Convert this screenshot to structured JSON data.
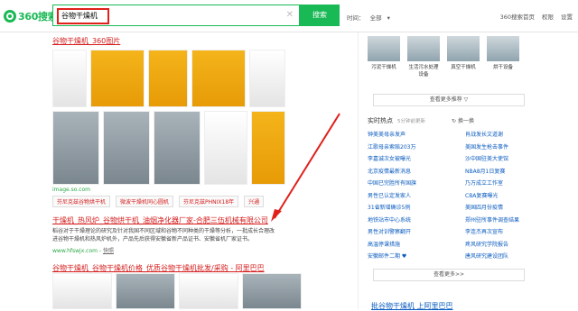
{
  "header": {
    "logo": "360搜索",
    "query": "谷物干燥机",
    "search_button": "搜索",
    "filter_time": "时间：",
    "filter_all": "全部",
    "links": [
      "360搜索首页",
      "权限",
      "设置"
    ]
  },
  "results": {
    "images_title": "谷物干燥机_360图片",
    "image_source": "image.so.com",
    "tags": [
      "芬尼克兹谷物烘干机",
      "微波干燥机同心圆机",
      "芬尼克兹PHNIX18年",
      "兴通"
    ],
    "res2_title": "干燥机_热风炉_谷物烘干机_油烟净化器厂家-合肥三伍机械有限公司",
    "res2_desc": "稻谷对于干燥理论的研究及针对我国不同区域和谷物不同种类的干燥等分析，一批成长合理改进谷物干燥机和热风炉机外，产品先后获得安徽省新产品证书、安徽省机厂家证书。",
    "res2_url": "www.hfswjx.com",
    "res2_cache": "快照",
    "res3_title": "谷物干燥机_谷物干燥机价格_优质谷物干燥机批发/采购 - 阿里巴巴"
  },
  "sidebar": {
    "related_images": [
      "污泥干燥机",
      "生活污水处理设备",
      "真空干燥机",
      "烘干设备"
    ],
    "more_related": "查看更多推荐 ▽",
    "hot_title": "实时热点",
    "hot_sub": "5分钟前更新",
    "hot_change": "换一换",
    "hot_items": [
      "钟美美母亲发声",
      "肖战发长文道谢",
      "江歌母亲索赔203万",
      "美国发生枪击事件",
      "李嘉诚次女被曝光",
      "沙中国驻美大使馆",
      "北京疫情最新消息",
      "NBA8月1日复赛",
      "中国已完胜所有国旗",
      "乃万成立工作室",
      "男性已认定发家人",
      "CBA复赛曝光",
      "31省新增确诊5例",
      "美国四月份疫情",
      "地铁站市中心系统",
      "郑州驻所事件调查结果",
      "男性对训警察翻开",
      "李连杰再次宣布",
      "高温停课措施",
      "疼风研究学院报告",
      "安徽邮件二期 ♥",
      "唐风研究建设团队"
    ],
    "more_hot": "查看更多>>",
    "bottom_link": "批谷物干燥机 上阿里巴巴"
  },
  "colors": {
    "accent": "#19b955",
    "title_red": "#d41c1c",
    "link_blue": "#0a5bbf"
  }
}
